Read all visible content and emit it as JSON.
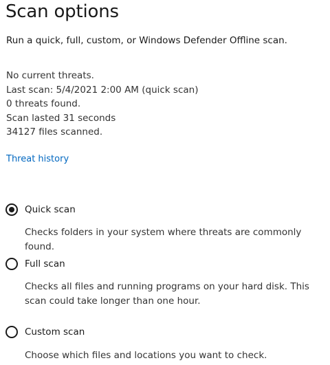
{
  "page": {
    "title": "Scan options",
    "subtitle": "Run a quick, full, custom, or Windows Defender Offline scan."
  },
  "status": {
    "current_threats": "No current threats.",
    "last_scan": "Last scan: 5/4/2021 2:00 AM (quick scan)",
    "threats_found": "0 threats found.",
    "duration": "Scan lasted 31 seconds",
    "files_scanned": "34127 files scanned."
  },
  "links": {
    "threat_history": "Threat history"
  },
  "scan_options": [
    {
      "label": "Quick scan",
      "description": "Checks folders in your system where threats are commonly found.",
      "selected": true
    },
    {
      "label": "Full scan",
      "description": "Checks all files and running programs on your hard disk. This scan could take longer than one hour.",
      "selected": false
    },
    {
      "label": "Custom scan",
      "description": "Choose which files and locations you want to check.",
      "selected": false
    }
  ],
  "colors": {
    "link": "#0067c0",
    "text": "#1a1a1a",
    "secondary_text": "#333333"
  }
}
